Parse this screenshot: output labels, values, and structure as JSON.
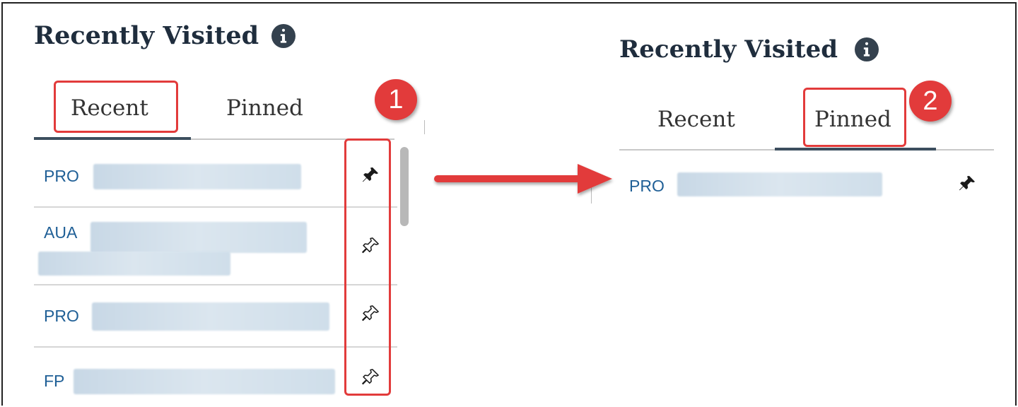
{
  "left_panel": {
    "title": "Recently Visited",
    "tabs": [
      {
        "label": "Recent",
        "active": true
      },
      {
        "label": "Pinned",
        "active": false
      }
    ],
    "items": [
      {
        "prefix": "PRO",
        "pinned": true
      },
      {
        "prefix": "AUA",
        "pinned": false
      },
      {
        "prefix": "PRO",
        "pinned": false
      },
      {
        "prefix": "FP",
        "pinned": false
      }
    ]
  },
  "right_panel": {
    "title": "Recently Visited",
    "tabs": [
      {
        "label": "Recent",
        "active": false
      },
      {
        "label": "Pinned",
        "active": true
      }
    ],
    "items": [
      {
        "prefix": "PRO",
        "pinned": true
      }
    ]
  },
  "annotations": {
    "step1": "1",
    "step2": "2"
  },
  "colors": {
    "accent_red": "#e23b3b",
    "link_blue": "#1f5f96",
    "title_dark": "#1f2d3d",
    "tab_underline": "#3c4e5e"
  },
  "icons": {
    "info": "info-circle-icon",
    "pin_filled": "pin-filled-icon",
    "pin_outline": "pin-outline-icon",
    "arrow": "arrow-right-icon"
  }
}
